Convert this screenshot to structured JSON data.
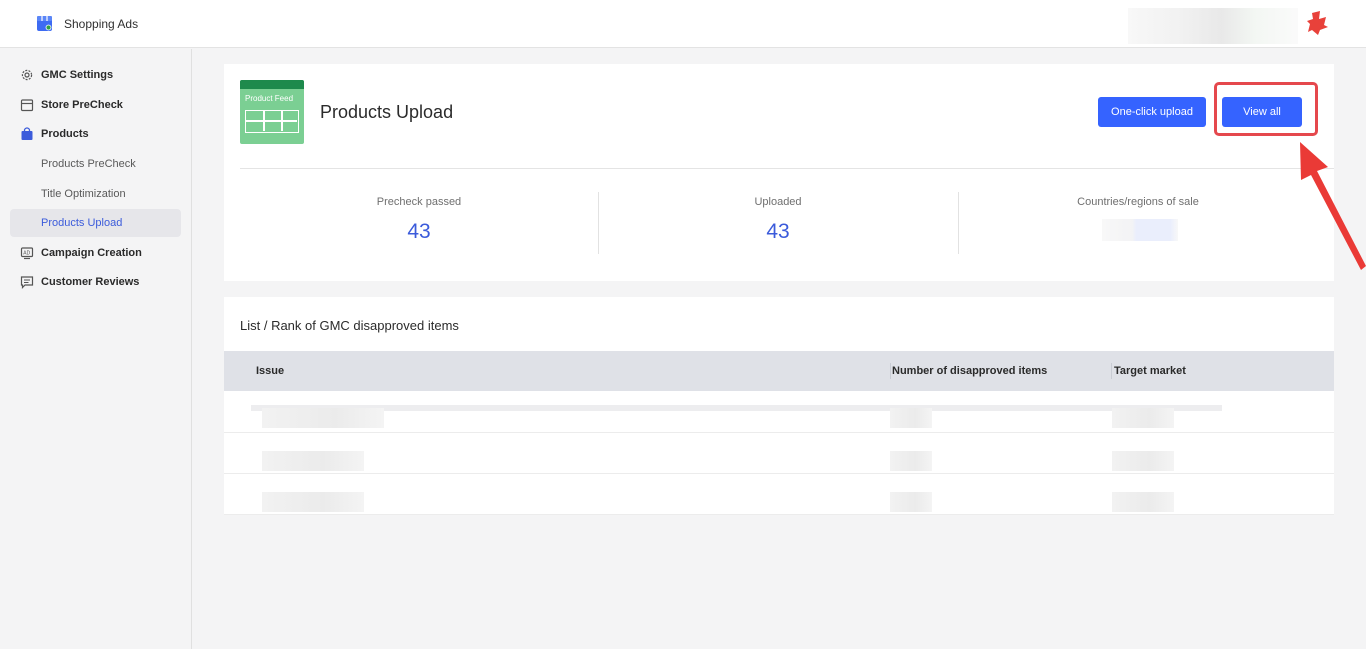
{
  "topbar": {
    "app_title": "Shopping Ads",
    "app_icon": "store-icon",
    "brand_icon": "brand-logo-icon"
  },
  "sidebar": {
    "items": [
      {
        "label": "GMC Settings",
        "icon": "gear-icon",
        "level": "top"
      },
      {
        "label": "Store PreCheck",
        "icon": "storefront-icon",
        "level": "top"
      },
      {
        "label": "Products",
        "icon": "shopping-bag-icon",
        "level": "top"
      },
      {
        "label": "Products PreCheck",
        "level": "sub"
      },
      {
        "label": "Title Optimization",
        "level": "sub"
      },
      {
        "label": "Products Upload",
        "level": "sub",
        "active": true
      },
      {
        "label": "Campaign Creation",
        "icon": "ad-icon",
        "level": "top"
      },
      {
        "label": "Customer Reviews",
        "icon": "comment-icon",
        "level": "top"
      }
    ]
  },
  "upload_card": {
    "feed_icon_text": "Product Feed",
    "title": "Products Upload",
    "one_click_label": "One-click upload",
    "view_all_label": "View all",
    "stats": [
      {
        "label": "Precheck passed",
        "value": "43"
      },
      {
        "label": "Uploaded",
        "value": "43"
      },
      {
        "label": "Countries/regions of sale",
        "value": ""
      }
    ]
  },
  "list_card": {
    "title": "List / Rank of GMC disapproved items",
    "columns": [
      "Issue",
      "Number of disapproved items",
      "Target market"
    ]
  },
  "colors": {
    "primary": "#3563ff",
    "accent_text": "#3b5bdb",
    "highlight": "#e5484d",
    "feed_green": "#7bcf93"
  }
}
